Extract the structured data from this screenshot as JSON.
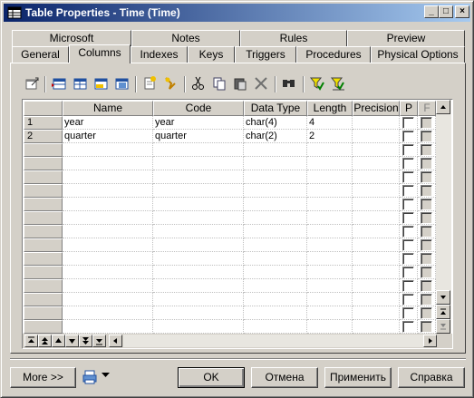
{
  "window": {
    "title": "Table Properties - Time (Time)",
    "minimize_glyph": "_",
    "maximize_glyph": "□",
    "close_glyph": "×"
  },
  "tabs": {
    "row_back": [
      {
        "label": "Microsoft"
      },
      {
        "label": "Notes"
      },
      {
        "label": "Rules"
      },
      {
        "label": "Preview"
      }
    ],
    "row_front": [
      {
        "label": "General"
      },
      {
        "label": "Columns"
      },
      {
        "label": "Indexes"
      },
      {
        "label": "Keys"
      },
      {
        "label": "Triggers"
      },
      {
        "label": "Procedures"
      },
      {
        "label": "Physical Options"
      }
    ],
    "active": "Columns"
  },
  "toolbar": {
    "icons": [
      "properties-icon",
      "insert-row-icon",
      "add-row-icon",
      "add-rows-icon",
      "copy-rows-icon",
      "new-icon",
      "paste-special-icon",
      "cut-icon",
      "copy-icon",
      "paste-icon",
      "delete-icon",
      "find-icon",
      "filter-icon",
      "filter-clear-icon"
    ]
  },
  "grid": {
    "columns": [
      {
        "label": "Name"
      },
      {
        "label": "Code"
      },
      {
        "label": "Data Type"
      },
      {
        "label": "Length"
      },
      {
        "label": "Precision"
      },
      {
        "label": "P"
      },
      {
        "label": "F"
      }
    ],
    "rows": [
      {
        "num": "1",
        "name": "year",
        "code": "year",
        "data_type": "char(4)",
        "length": "4",
        "precision": ""
      },
      {
        "num": "2",
        "name": "quarter",
        "code": "quarter",
        "data_type": "char(2)",
        "length": "2",
        "precision": ""
      }
    ],
    "empty_rows": 14
  },
  "buttons": {
    "more": "More >>",
    "ok": "OK",
    "cancel": "Отмена",
    "apply": "Применить",
    "help": "Справка"
  }
}
